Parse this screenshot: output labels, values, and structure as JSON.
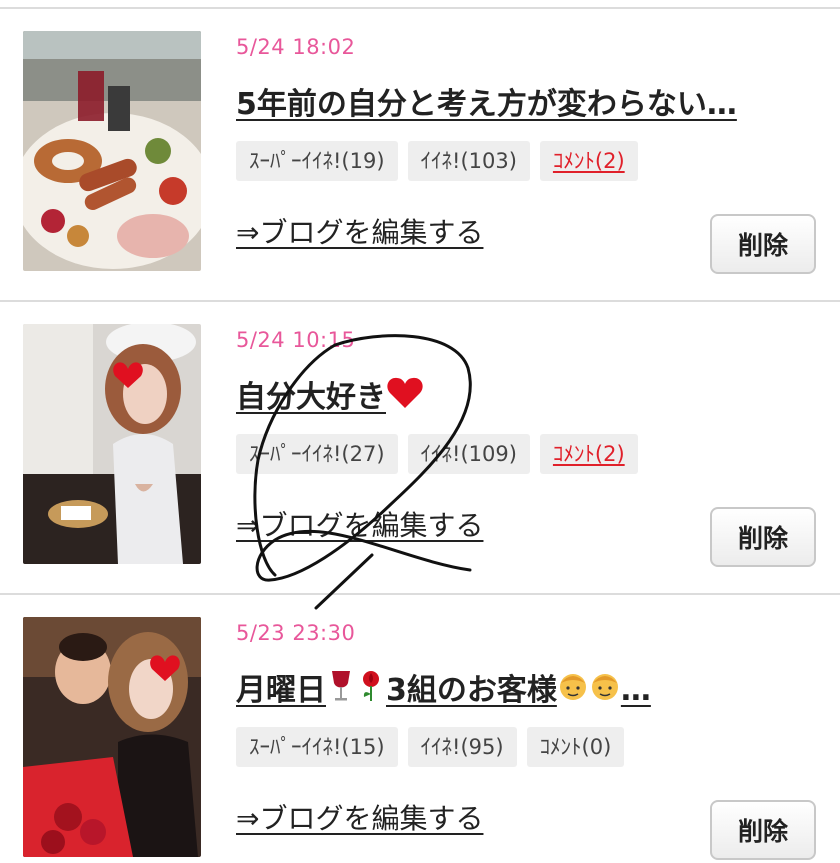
{
  "posts": [
    {
      "date": "5/24 18:02",
      "title": "5年前の自分と考え方が変わらない…",
      "tags": {
        "super_like": "ｽｰﾊﾟｰｲｲﾈ!(19)",
        "like": "ｲｲﾈ!(103)",
        "comment": "ｺﾒﾝﾄ(2)"
      },
      "edit_link": "⇒ブログを編集する",
      "delete_label": "削除"
    },
    {
      "date": "5/24 10:15",
      "title": "自分大好き",
      "title_emoji": "heart-icon",
      "tags": {
        "super_like": "ｽｰﾊﾟｰｲｲﾈ!(27)",
        "like": "ｲｲﾈ!(109)",
        "comment": "ｺﾒﾝﾄ(2)"
      },
      "edit_link": "⇒ブログを編集する",
      "delete_label": "削除"
    },
    {
      "date": "5/23 23:30",
      "title_part1": "月曜日",
      "title_part2": "3組のお客様",
      "title_ellipsis": "…",
      "title_emojis": [
        "wine-glass-icon",
        "rose-icon",
        "boy-face-icon",
        "boy-face-icon"
      ],
      "tags": {
        "super_like": "ｽｰﾊﾟｰｲｲﾈ!(15)",
        "like": "ｲｲﾈ!(95)",
        "comment": "ｺﾒﾝﾄ(0)"
      },
      "edit_link": "⇒ブログを編集する",
      "delete_label": "削除"
    }
  ],
  "colors": {
    "date": "#e8579a",
    "comment_active": "#e0202a",
    "tag_bg": "#eeeeee",
    "divider": "#dcdcdc"
  }
}
